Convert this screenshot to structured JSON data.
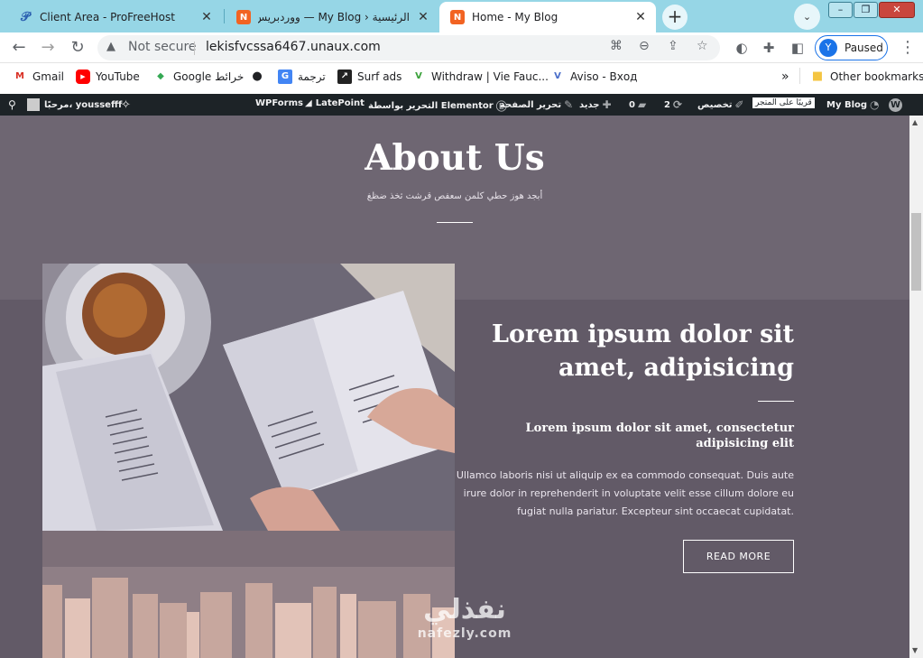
{
  "browser": {
    "tabs": [
      {
        "title": "Client Area - ProFreeHost",
        "icon": "profreehost-icon",
        "active": false
      },
      {
        "title": "الرئيسية ‹ My Blog — ووردبريس",
        "icon": "nofezly-icon",
        "active": false
      },
      {
        "title": "Home - My Blog",
        "icon": "nofezly-icon",
        "active": true
      }
    ],
    "new_tab": "+",
    "address": {
      "security": "Not secure",
      "url": "lekisfvcssa6467.unaux.com"
    },
    "profile": {
      "initial": "Y",
      "label": "Paused"
    },
    "bookmarks": [
      {
        "label": "Gmail",
        "icon": "gmail-icon"
      },
      {
        "label": "YouTube",
        "icon": "youtube-icon"
      },
      {
        "label": "Google خرائط",
        "icon": "maps-icon"
      },
      {
        "label": "",
        "icon": "globe-icon"
      },
      {
        "label": "ترجمة",
        "icon": "translate-icon"
      },
      {
        "label": "Surf ads",
        "icon": "surf-icon"
      },
      {
        "label": "Withdraw | Vie Fauc...",
        "icon": "faucet-icon"
      },
      {
        "label": "Aviso - Вход",
        "icon": "aviso-icon"
      }
    ],
    "more_bookmarks": "»",
    "other_bookmarks": "Other bookmarks"
  },
  "admin_bar": {
    "site": "My Blog",
    "visit_store": "قريبًا على المتجر",
    "customize": "تخصيص",
    "updates": "2",
    "comments": "0",
    "new": "جديد",
    "edit_page": "تحرير الصفحة",
    "edit_elementor": "التحرير بواسطة Elementor",
    "latepoint": "LatePoint",
    "wpforms": "WPForms",
    "greeting": "مرحبًا، youssefff"
  },
  "hero": {
    "title": "About Us",
    "subtitle": "أبجد هوز حطي كلمن سعفص قرشت ثخذ ضظغ"
  },
  "feature": {
    "heading": "Lorem ipsum dolor sit amet, adipisicing",
    "subheading": "Lorem ipsum dolor sit amet, consectetur adipisicing elit",
    "paragraph": "Ullamco laboris nisi ut aliquip ex ea commodo consequat. Duis aute irure dolor in reprehenderit in voluptate velit esse cillum dolore eu fugiat nulla pariatur. Excepteur sint occaecat cupidatat.",
    "button": "READ MORE"
  },
  "watermark": {
    "arabic": "نفذلي",
    "latin": "nafezly.com"
  },
  "colors": {
    "page_bg": "#6e6672",
    "band_bg": "#625a67",
    "admin_bar": "#1d2327",
    "tab_strip": "#96d6e6",
    "accent": "#1a73e8"
  }
}
